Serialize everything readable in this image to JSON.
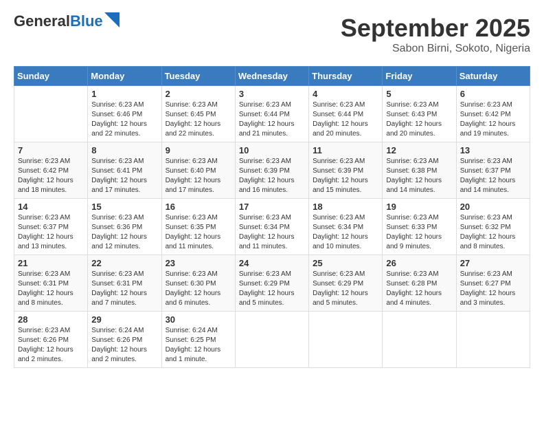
{
  "header": {
    "logo_general": "General",
    "logo_blue": "Blue",
    "month": "September 2025",
    "location": "Sabon Birni, Sokoto, Nigeria"
  },
  "days_of_week": [
    "Sunday",
    "Monday",
    "Tuesday",
    "Wednesday",
    "Thursday",
    "Friday",
    "Saturday"
  ],
  "weeks": [
    [
      {
        "day": "",
        "empty": true
      },
      {
        "day": "1",
        "sunrise": "6:23 AM",
        "sunset": "6:46 PM",
        "daylight": "12 hours and 22 minutes."
      },
      {
        "day": "2",
        "sunrise": "6:23 AM",
        "sunset": "6:45 PM",
        "daylight": "12 hours and 22 minutes."
      },
      {
        "day": "3",
        "sunrise": "6:23 AM",
        "sunset": "6:44 PM",
        "daylight": "12 hours and 21 minutes."
      },
      {
        "day": "4",
        "sunrise": "6:23 AM",
        "sunset": "6:44 PM",
        "daylight": "12 hours and 20 minutes."
      },
      {
        "day": "5",
        "sunrise": "6:23 AM",
        "sunset": "6:43 PM",
        "daylight": "12 hours and 20 minutes."
      },
      {
        "day": "6",
        "sunrise": "6:23 AM",
        "sunset": "6:42 PM",
        "daylight": "12 hours and 19 minutes."
      }
    ],
    [
      {
        "day": "7",
        "sunrise": "6:23 AM",
        "sunset": "6:42 PM",
        "daylight": "12 hours and 18 minutes."
      },
      {
        "day": "8",
        "sunrise": "6:23 AM",
        "sunset": "6:41 PM",
        "daylight": "12 hours and 17 minutes."
      },
      {
        "day": "9",
        "sunrise": "6:23 AM",
        "sunset": "6:40 PM",
        "daylight": "12 hours and 17 minutes."
      },
      {
        "day": "10",
        "sunrise": "6:23 AM",
        "sunset": "6:39 PM",
        "daylight": "12 hours and 16 minutes."
      },
      {
        "day": "11",
        "sunrise": "6:23 AM",
        "sunset": "6:39 PM",
        "daylight": "12 hours and 15 minutes."
      },
      {
        "day": "12",
        "sunrise": "6:23 AM",
        "sunset": "6:38 PM",
        "daylight": "12 hours and 14 minutes."
      },
      {
        "day": "13",
        "sunrise": "6:23 AM",
        "sunset": "6:37 PM",
        "daylight": "12 hours and 14 minutes."
      }
    ],
    [
      {
        "day": "14",
        "sunrise": "6:23 AM",
        "sunset": "6:37 PM",
        "daylight": "12 hours and 13 minutes."
      },
      {
        "day": "15",
        "sunrise": "6:23 AM",
        "sunset": "6:36 PM",
        "daylight": "12 hours and 12 minutes."
      },
      {
        "day": "16",
        "sunrise": "6:23 AM",
        "sunset": "6:35 PM",
        "daylight": "12 hours and 11 minutes."
      },
      {
        "day": "17",
        "sunrise": "6:23 AM",
        "sunset": "6:34 PM",
        "daylight": "12 hours and 11 minutes."
      },
      {
        "day": "18",
        "sunrise": "6:23 AM",
        "sunset": "6:34 PM",
        "daylight": "12 hours and 10 minutes."
      },
      {
        "day": "19",
        "sunrise": "6:23 AM",
        "sunset": "6:33 PM",
        "daylight": "12 hours and 9 minutes."
      },
      {
        "day": "20",
        "sunrise": "6:23 AM",
        "sunset": "6:32 PM",
        "daylight": "12 hours and 8 minutes."
      }
    ],
    [
      {
        "day": "21",
        "sunrise": "6:23 AM",
        "sunset": "6:31 PM",
        "daylight": "12 hours and 8 minutes."
      },
      {
        "day": "22",
        "sunrise": "6:23 AM",
        "sunset": "6:31 PM",
        "daylight": "12 hours and 7 minutes."
      },
      {
        "day": "23",
        "sunrise": "6:23 AM",
        "sunset": "6:30 PM",
        "daylight": "12 hours and 6 minutes."
      },
      {
        "day": "24",
        "sunrise": "6:23 AM",
        "sunset": "6:29 PM",
        "daylight": "12 hours and 5 minutes."
      },
      {
        "day": "25",
        "sunrise": "6:23 AM",
        "sunset": "6:29 PM",
        "daylight": "12 hours and 5 minutes."
      },
      {
        "day": "26",
        "sunrise": "6:23 AM",
        "sunset": "6:28 PM",
        "daylight": "12 hours and 4 minutes."
      },
      {
        "day": "27",
        "sunrise": "6:23 AM",
        "sunset": "6:27 PM",
        "daylight": "12 hours and 3 minutes."
      }
    ],
    [
      {
        "day": "28",
        "sunrise": "6:23 AM",
        "sunset": "6:26 PM",
        "daylight": "12 hours and 2 minutes."
      },
      {
        "day": "29",
        "sunrise": "6:24 AM",
        "sunset": "6:26 PM",
        "daylight": "12 hours and 2 minutes."
      },
      {
        "day": "30",
        "sunrise": "6:24 AM",
        "sunset": "6:25 PM",
        "daylight": "12 hours and 1 minute."
      },
      {
        "day": "",
        "empty": true
      },
      {
        "day": "",
        "empty": true
      },
      {
        "day": "",
        "empty": true
      },
      {
        "day": "",
        "empty": true
      }
    ]
  ]
}
